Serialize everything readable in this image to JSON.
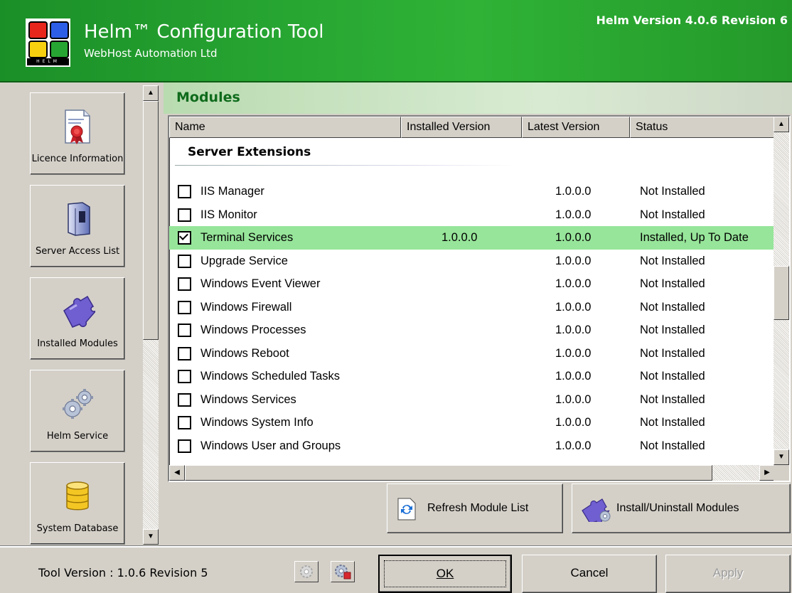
{
  "header": {
    "title": "Helm™ Configuration Tool",
    "subtitle": "WebHost Automation Ltd",
    "version": "Helm Version 4.0.6 Revision 6",
    "logo_text": "HELM",
    "logo_colors": [
      "#e8261c",
      "#2d5ee8",
      "#f7d10f",
      "#27a532"
    ]
  },
  "nav": {
    "items": [
      {
        "label": "Licence Information",
        "icon": "certificate-icon"
      },
      {
        "label": "Server Access List",
        "icon": "server-tower-icon"
      },
      {
        "label": "Installed Modules",
        "icon": "puzzle-piece-icon"
      },
      {
        "label": "Helm Service",
        "icon": "gears-icon"
      },
      {
        "label": "System Database",
        "icon": "database-icon"
      }
    ]
  },
  "main": {
    "title": "Modules",
    "columns": [
      "Name",
      "Installed Version",
      "Latest Version",
      "Status"
    ],
    "group": "Server Extensions",
    "rows": [
      {
        "name": "IIS Manager",
        "installed": "",
        "latest": "1.0.0.0",
        "status": "Not Installed",
        "checked": false
      },
      {
        "name": "IIS Monitor",
        "installed": "",
        "latest": "1.0.0.0",
        "status": "Not Installed",
        "checked": false
      },
      {
        "name": "Terminal Services",
        "installed": "1.0.0.0",
        "latest": "1.0.0.0",
        "status": "Installed, Up To Date",
        "checked": true
      },
      {
        "name": "Upgrade Service",
        "installed": "",
        "latest": "1.0.0.0",
        "status": "Not Installed",
        "checked": false
      },
      {
        "name": "Windows Event Viewer",
        "installed": "",
        "latest": "1.0.0.0",
        "status": "Not Installed",
        "checked": false
      },
      {
        "name": "Windows Firewall",
        "installed": "",
        "latest": "1.0.0.0",
        "status": "Not Installed",
        "checked": false
      },
      {
        "name": "Windows Processes",
        "installed": "",
        "latest": "1.0.0.0",
        "status": "Not Installed",
        "checked": false
      },
      {
        "name": "Windows Reboot",
        "installed": "",
        "latest": "1.0.0.0",
        "status": "Not Installed",
        "checked": false
      },
      {
        "name": "Windows Scheduled Tasks",
        "installed": "",
        "latest": "1.0.0.0",
        "status": "Not Installed",
        "checked": false
      },
      {
        "name": "Windows Services",
        "installed": "",
        "latest": "1.0.0.0",
        "status": "Not Installed",
        "checked": false
      },
      {
        "name": "Windows System Info",
        "installed": "",
        "latest": "1.0.0.0",
        "status": "Not Installed",
        "checked": false
      },
      {
        "name": "Windows User and Groups",
        "installed": "",
        "latest": "1.0.0.0",
        "status": "Not Installed",
        "checked": false
      }
    ],
    "actions": {
      "refresh": "Refresh Module List",
      "install": "Install/Uninstall Modules"
    },
    "accent": "#97e59a"
  },
  "footer": {
    "tool_version": "Tool Version : 1.0.6 Revision 5",
    "ok": "OK",
    "cancel": "Cancel",
    "apply": "Apply"
  }
}
